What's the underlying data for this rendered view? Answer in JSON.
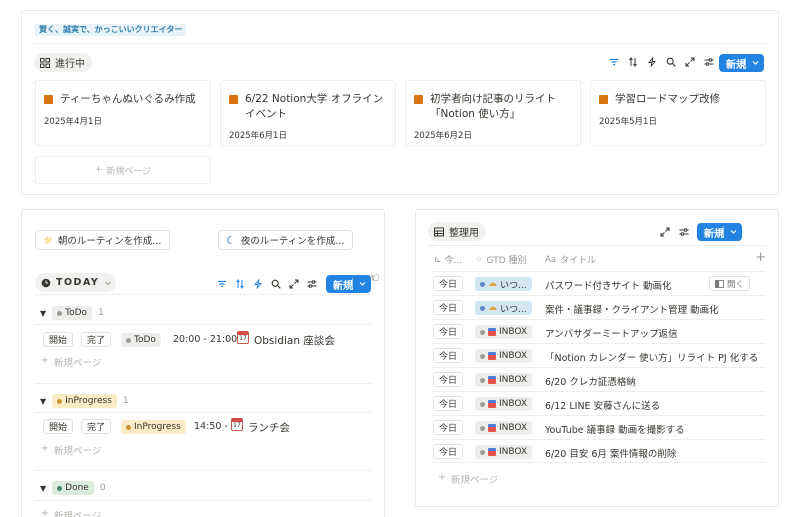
{
  "top": {
    "tag": "賢く、誠実で、かっこいいクリエイター",
    "view_label": "進行中",
    "new_label": "新規",
    "new_page": "新規ページ",
    "cards": [
      {
        "title": "ティーちゃんぬいぐるみ作成",
        "date": "2025年4月1日"
      },
      {
        "title": "6/22 Notion大学 オフラインイベント",
        "date": "2025年6月1日"
      },
      {
        "title": "初学者向け記事のリライト「Notion 使い方」",
        "date": "2025年6月2日"
      },
      {
        "title": "学習ロードマップ改修",
        "date": "2025年5月1日"
      }
    ]
  },
  "routine": {
    "morning": "朝のルーティンを作成...",
    "night": "夜のルーティンを作成...",
    "view_label": "TODAY",
    "new_label": "新規",
    "groups": [
      {
        "name": "ToDo",
        "count": "1",
        "start": "開始",
        "done": "完了",
        "status": "ToDo",
        "time": "20:00 - 21:00",
        "title": "Obsidian 座談会",
        "new_page": "新規ページ",
        "color": "#9b9a97",
        "bg": "#ededec"
      },
      {
        "name": "InProgress",
        "count": "1",
        "start": "開始",
        "done": "完了",
        "status": "InProgress",
        "time": "14:50 -",
        "title": "ランチ会",
        "new_page": "新規ページ",
        "color": "#cb912f",
        "bg": "#fbecc8"
      },
      {
        "name": "Done",
        "count": "0",
        "new_page": "新規ページ",
        "color": "#448361",
        "bg": "#dbeddb"
      }
    ]
  },
  "table": {
    "view_label": "整理用",
    "new_label": "新規",
    "headers": {
      "date": "今...",
      "gtd": "GTD 種別",
      "title": "タイトル",
      "title_prefix": "Aa"
    },
    "open_label": "開く",
    "new_page": "新規ページ",
    "rows": [
      {
        "date": "今日",
        "type": "いつ...",
        "icon": "☁",
        "title": "パスワード付きサイト 動画化",
        "blue": true
      },
      {
        "date": "今日",
        "type": "いつ...",
        "icon": "☁",
        "title": "案件・議事録・クライアント管理 動画化",
        "blue": true
      },
      {
        "date": "今日",
        "type": "INBOX",
        "icon": "📥",
        "title": "アンバサダーミートアップ返信",
        "blue": false
      },
      {
        "date": "今日",
        "type": "INBOX",
        "icon": "📥",
        "title": "「Notion カレンダー 使い方」リライト PJ 化する",
        "blue": false
      },
      {
        "date": "今日",
        "type": "INBOX",
        "icon": "📥",
        "title": "6/20 クレカ証憑格納",
        "blue": false
      },
      {
        "date": "今日",
        "type": "INBOX",
        "icon": "📥",
        "title": "6/12 LINE 安藤さんに送る",
        "blue": false
      },
      {
        "date": "今日",
        "type": "INBOX",
        "icon": "📥",
        "title": "YouTube 議事録 動画を撮影する",
        "blue": false
      },
      {
        "date": "今日",
        "type": "INBOX",
        "icon": "📥",
        "title": "6/20 目安 6月 案件情報の削除",
        "blue": false
      }
    ]
  }
}
